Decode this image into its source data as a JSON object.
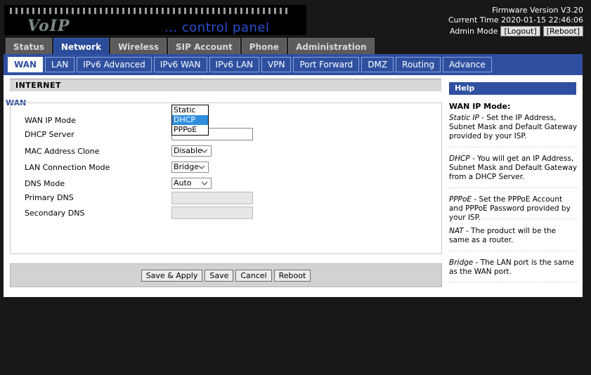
{
  "header": {
    "logo_main": "VoIP",
    "logo_sub": "... control panel",
    "firmware": "Firmware Version V3.20",
    "current_time": "Current Time 2020-01-15 22:46:06",
    "mode": "Admin Mode",
    "logout_label": "[Logout]",
    "reboot_label": "[Reboot]"
  },
  "main_tabs": [
    {
      "label": "Status",
      "active": false
    },
    {
      "label": "Network",
      "active": true
    },
    {
      "label": "Wireless",
      "active": false
    },
    {
      "label": "SIP Account",
      "active": false
    },
    {
      "label": "Phone",
      "active": false
    },
    {
      "label": "Administration",
      "active": false
    }
  ],
  "sub_tabs": [
    {
      "label": "WAN",
      "active": true
    },
    {
      "label": "LAN",
      "active": false
    },
    {
      "label": "IPv6 Advanced",
      "active": false
    },
    {
      "label": "IPv6 WAN",
      "active": false
    },
    {
      "label": "IPv6 LAN",
      "active": false
    },
    {
      "label": "VPN",
      "active": false
    },
    {
      "label": "Port Forward",
      "active": false
    },
    {
      "label": "DMZ",
      "active": false
    },
    {
      "label": "Routing",
      "active": false
    },
    {
      "label": "Advance",
      "active": false
    }
  ],
  "section": {
    "title": "INTERNET",
    "group": "WAN"
  },
  "form": {
    "wan_ip_mode_label": "WAN IP Mode",
    "wan_ip_mode_options": [
      "Static",
      "DHCP",
      "PPPoE"
    ],
    "wan_ip_mode_selected": "DHCP",
    "dhcp_server_label": "DHCP Server",
    "dhcp_server_value": "",
    "mac_clone_label": "MAC Address Clone",
    "mac_clone_value": "Disable",
    "lan_mode_label": "LAN Connection Mode",
    "lan_mode_value": "Bridge",
    "dns_mode_label": "DNS Mode",
    "dns_mode_value": "Auto",
    "primary_dns_label": "Primary DNS",
    "primary_dns_value": "",
    "secondary_dns_label": "Secondary DNS",
    "secondary_dns_value": ""
  },
  "buttons": {
    "save_apply": "Save & Apply",
    "save": "Save",
    "cancel": "Cancel",
    "reboot": "Reboot"
  },
  "help": {
    "title": "Help",
    "subtitle": "WAN IP Mode:",
    "items": [
      {
        "term": "Static IP",
        "text": " - Set the IP Address, Subnet Mask and Default Gateway provided by your ISP."
      },
      {
        "term": "DHCP",
        "text": " - You will get an IP Address, Subnet Mask and Default Gateway from a DHCP Server."
      },
      {
        "term": "PPPoE",
        "text": " - Set the PPPoE Account and PPPoE Password provided by your ISP."
      },
      {
        "term": "NAT",
        "text": " - The product will be the same as a router."
      },
      {
        "term": "Bridge",
        "text": " - The LAN port is the same as the WAN port."
      }
    ]
  }
}
